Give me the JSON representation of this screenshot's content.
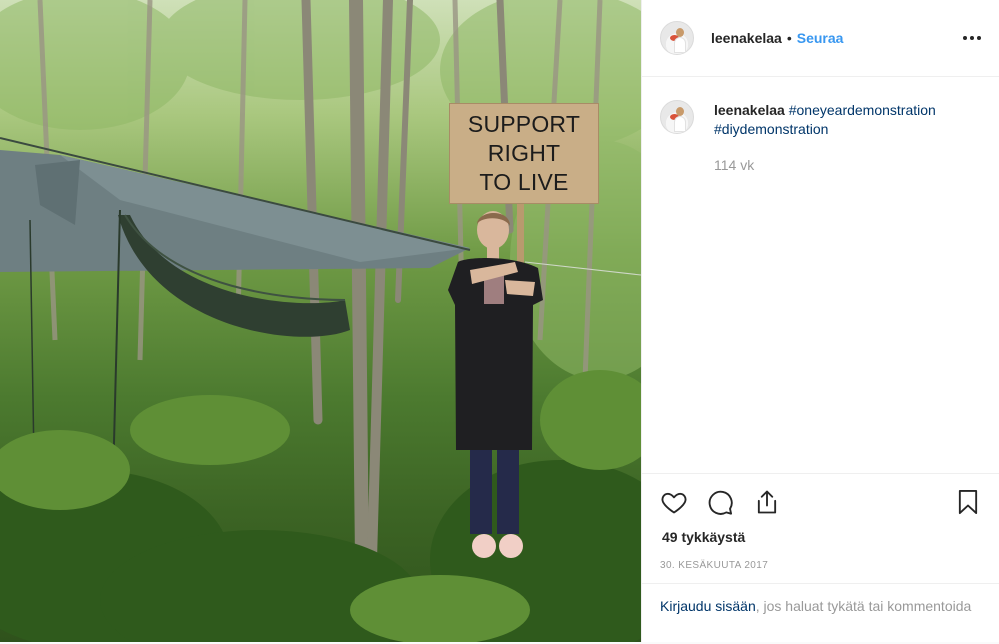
{
  "post": {
    "photo": {
      "sign_lines": [
        "SUPPORT",
        "RIGHT",
        "TO LIVE"
      ]
    },
    "header": {
      "username": "leenakelaa",
      "separator": "•",
      "follow_label": "Seuraa",
      "more_icon": "more-horizontal-icon"
    },
    "caption": {
      "username": "leenakelaa",
      "hashtags": [
        "#oneyeardemonstration",
        "#diydemonstration"
      ],
      "time_ago": "114 vk"
    },
    "actions": {
      "like_icon": "heart-icon",
      "comment_icon": "comment-icon",
      "share_icon": "share-icon",
      "save_icon": "bookmark-icon",
      "likes_text": "49 tykkäystä",
      "date": "30. KESÄKUUTA 2017"
    },
    "login_prompt": {
      "link_text": "Kirjaudu sisään",
      "rest_text": ", jos haluat tykätä tai kommentoida"
    },
    "colors": {
      "link_blue": "#3897f0",
      "hashtag_blue": "#003569",
      "muted": "#999999"
    }
  }
}
